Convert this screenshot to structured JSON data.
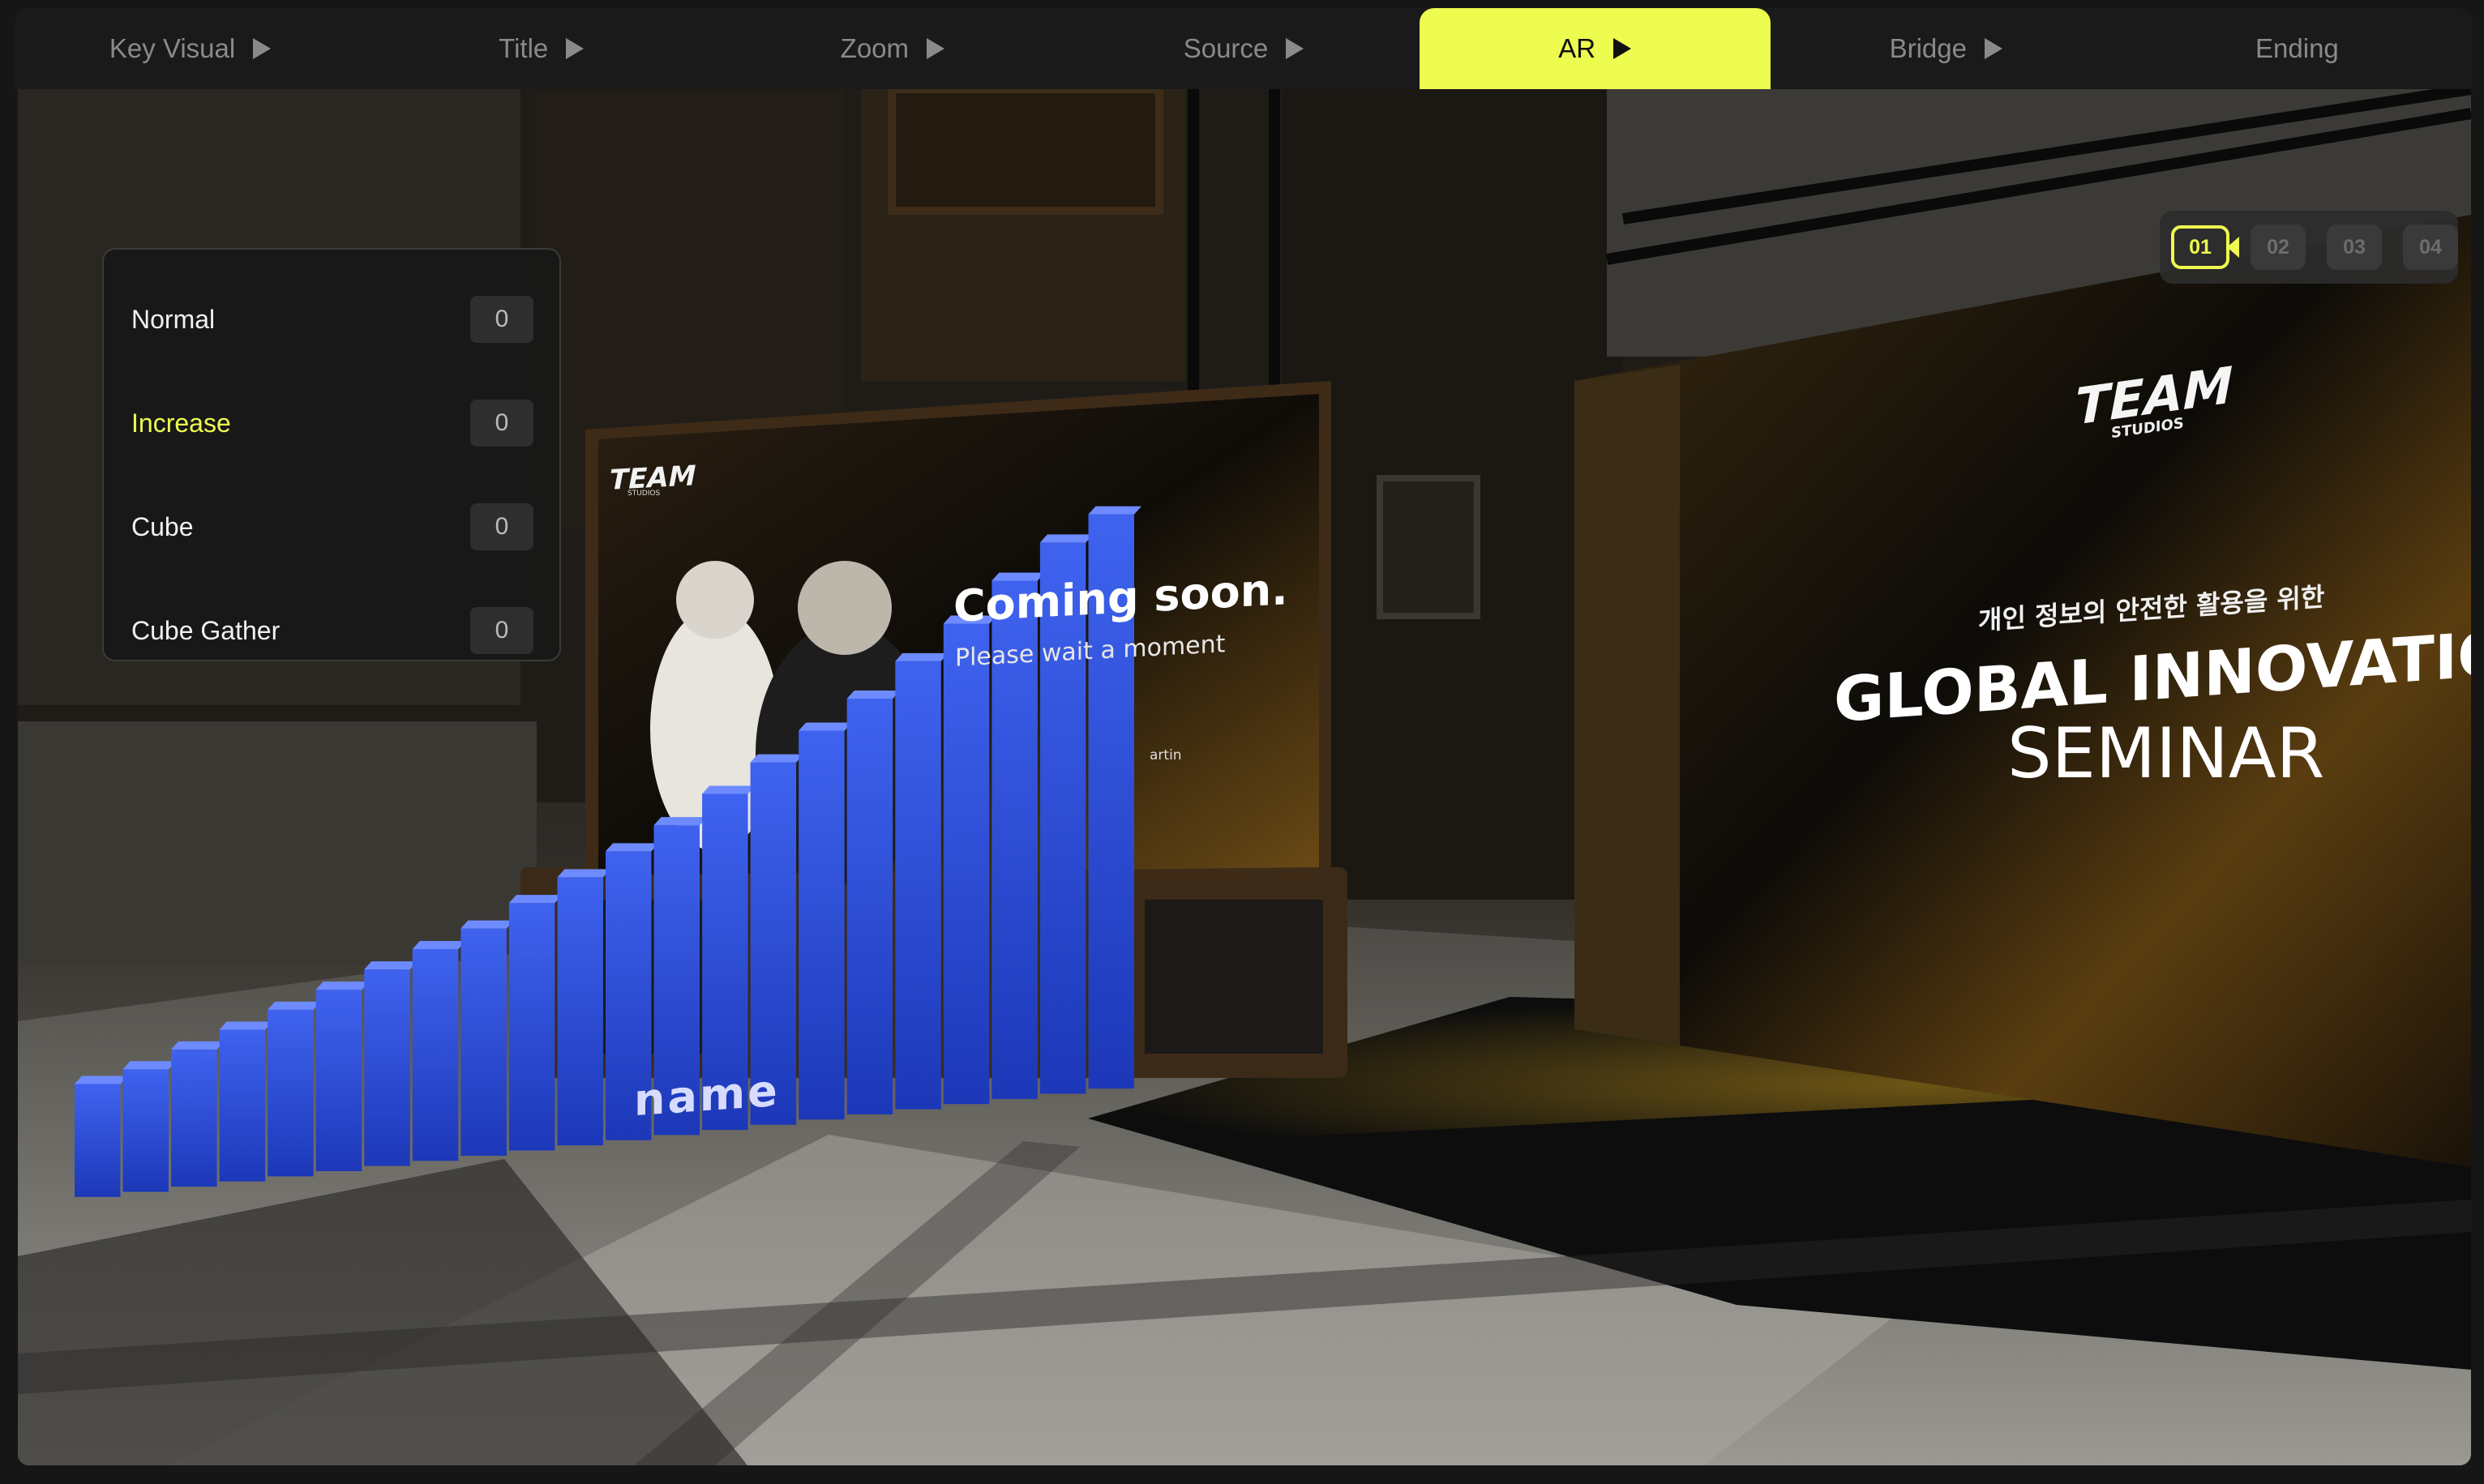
{
  "nav": {
    "tabs": [
      {
        "label": "Key Visual",
        "active": false,
        "play": true
      },
      {
        "label": "Title",
        "active": false,
        "play": true
      },
      {
        "label": "Zoom",
        "active": false,
        "play": true
      },
      {
        "label": "Source",
        "active": false,
        "play": true
      },
      {
        "label": "AR",
        "active": true,
        "play": true
      },
      {
        "label": "Bridge",
        "active": false,
        "play": true
      },
      {
        "label": "Ending",
        "active": false,
        "play": false
      }
    ],
    "accent_color": "#eefb4f"
  },
  "counters": {
    "items": [
      {
        "label": "Normal",
        "value": "0"
      },
      {
        "label": "Increase",
        "value": "0"
      },
      {
        "label": "Cube",
        "value": "0"
      },
      {
        "label": "Cube Gather",
        "value": "0"
      }
    ],
    "highlight_color": "#eefb4f"
  },
  "camera": {
    "icon": "video-camera-icon",
    "buttons": [
      "01",
      "02",
      "03",
      "04"
    ],
    "active": "01"
  },
  "scene": {
    "monitor": {
      "logo": "TEAM",
      "logo_sub": "STUDIOS",
      "heading": "Coming soon.",
      "subheading": "Please wait a moment",
      "name_tag": "artin"
    },
    "banner": {
      "logo": "TEAM",
      "logo_sub": "STUDIOS",
      "korean": "개인 정보의 안전한 활용을 위한",
      "title_line1": "GLOBAL INNOVATIO",
      "title_line2": "SEMINAR"
    },
    "bar_label": "name",
    "bar_color": "#2b4fe0",
    "bar_levels": [
      0.12,
      0.14,
      0.17,
      0.2,
      0.23,
      0.26,
      0.29,
      0.32,
      0.35,
      0.39,
      0.43,
      0.47,
      0.51,
      0.56,
      0.61,
      0.66,
      0.71,
      0.77,
      0.83,
      0.9,
      0.96,
      1.0
    ]
  }
}
